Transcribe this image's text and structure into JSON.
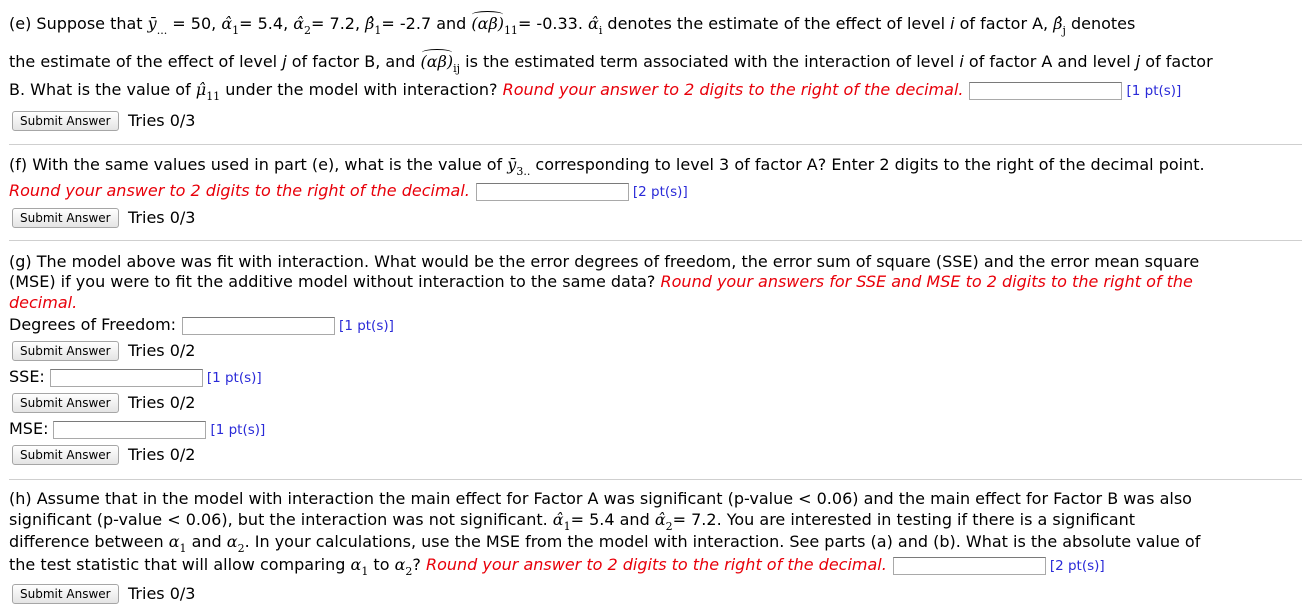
{
  "common": {
    "submit_label": "Submit Answer",
    "round2": "Round your answer to 2 digits to the right of the decimal."
  },
  "e": {
    "line1_a": "(e) Suppose that ",
    "ybar": "ȳ",
    "ybar_sub": "...",
    "eq1": " = 50, ",
    "a1": "α̂",
    "a1_sub": "1",
    "eq2": "= 5.4, ",
    "a2": "α̂",
    "a2_sub": "2",
    "eq3": "= 7.2, ",
    "b1": "β̂",
    "b1_sub": "1",
    "eq4": "= -2.7 and ",
    "ab": "(αβ)",
    "ab_sub": "11",
    "eq5": "= -0.33. ",
    "ai": "α̂",
    "ai_sub": "i",
    "line1_b": " denotes the estimate of the effect of level ",
    "i_var": "i",
    "line1_c": " of factor A, ",
    "bj": "β̂",
    "bj_sub": "j",
    "line1_d": " denotes",
    "line2_a": "the estimate of the effect of level ",
    "j_var": "j",
    "line2_b": " of factor B, and ",
    "abij": "(αβ)",
    "abij_sub": "ij",
    "line2_c": " is the estimated term associated with the interaction of level ",
    "line2_d": " of factor A and level ",
    "line2_e": " of factor",
    "line3_a": "B. What is the value of ",
    "mu": "μ̂",
    "mu_sub": "11",
    "line3_b": " under the model with interaction? ",
    "points": "[1 pt(s)]",
    "tries": "Tries 0/3",
    "answer": ""
  },
  "f": {
    "line1_a": "(f) With the same values used in part (e), what is the value of ",
    "y3": "ȳ",
    "y3_sub": "3..",
    "line1_b": " corresponding to level 3 of factor A? Enter 2 digits to the right of the decimal point.",
    "points": "[2 pt(s)]",
    "tries": "Tries 0/3",
    "answer": ""
  },
  "g": {
    "line1": "(g) The model above was fit with interaction. What would be the error degrees of freedom, the error sum of square (SSE) and the error mean square",
    "line2_a": "(MSE) if you were to fit the additive model without interaction to the same data? ",
    "line2_red": "Round your answers for SSE and MSE to 2 digits to the right of the",
    "line3_red": "decimal.",
    "df_label": "Degrees of Freedom:",
    "df_points": "[1 pt(s)]",
    "df_tries": "Tries 0/2",
    "df_answer": "",
    "sse_label": "SSE:",
    "sse_points": "[1 pt(s)]",
    "sse_tries": "Tries 0/2",
    "sse_answer": "",
    "mse_label": "MSE:",
    "mse_points": "[1 pt(s)]",
    "mse_tries": "Tries 0/2",
    "mse_answer": ""
  },
  "h": {
    "line1": "(h) Assume that in the model with interaction the main effect for Factor A was significant (p-value < 0.06) and the main effect for Factor B was also",
    "line2_a": "significant (p-value < 0.06), but the interaction was not significant. ",
    "a1": "α̂",
    "a1_sub": "1",
    "eq1": "= 5.4 and ",
    "a2": "α̂",
    "a2_sub": "2",
    "eq2": "= 7.2. You are interested in testing if there is a significant",
    "line3_a": "difference between ",
    "al1": "α",
    "al1_sub": "1",
    "and": " and ",
    "al2": "α",
    "al2_sub": "2",
    "line3_b": ". In your calculations, use the MSE from the model with interaction. See parts (a) and (b). What is the absolute value of",
    "line4_a": "the test statistic that will allow comparing ",
    "to": " to ",
    "q": "? ",
    "points": "[2 pt(s)]",
    "tries": "Tries 0/3",
    "answer": ""
  }
}
